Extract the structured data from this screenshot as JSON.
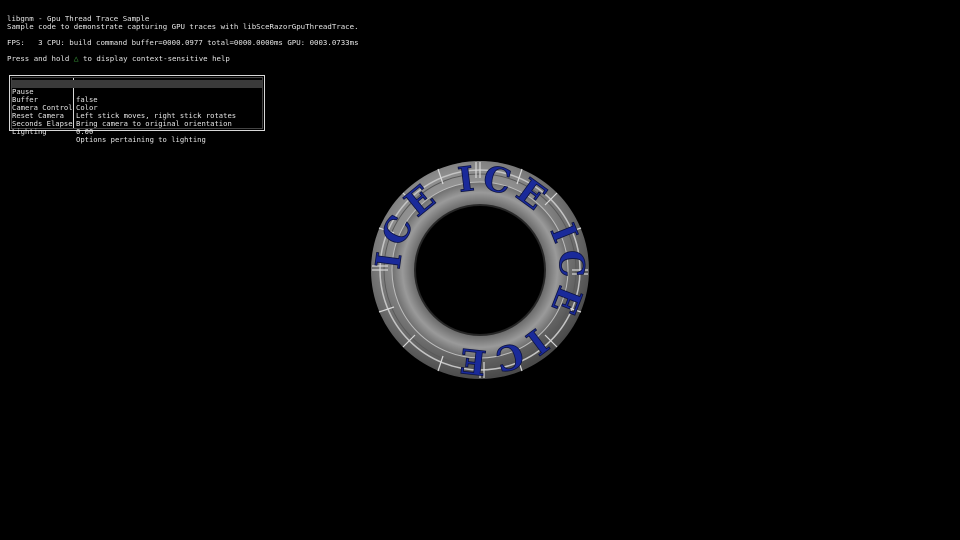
{
  "header": {
    "title": "libgnm - Gpu Thread Trace Sample",
    "subtitle": "Sample code to demonstrate capturing GPU traces with libSceRazorGpuThreadTrace.",
    "fps_line": "FPS:   3 CPU: build command buffer=0000.0977 total=0000.0000ms GPU: 0003.0733ms",
    "help_prefix": "Press and hold ",
    "help_button_icon": "triangle-button-icon",
    "help_suffix": " to display context-sensitive help"
  },
  "menu": {
    "items": [
      {
        "label": "Pause",
        "value": "false",
        "selected": true
      },
      {
        "label": "Buffer",
        "value": "Color",
        "selected": false
      },
      {
        "label": "Camera Controls",
        "value": "Left stick moves, right stick rotates",
        "selected": false
      },
      {
        "label": "Reset Camera",
        "value": "Bring camera to original orientation",
        "selected": false
      },
      {
        "label": "Seconds Elapsed",
        "value": "0.00",
        "selected": false
      },
      {
        "label": "Lighting",
        "value": "Options pertaining to lighting",
        "selected": false
      }
    ]
  },
  "scene": {
    "object": "textured-torus",
    "ring_text": "ICE ICE",
    "colors": {
      "background": "#000000",
      "ring_stone": "#8a8a8a",
      "letters": "#1a2a9a"
    }
  }
}
